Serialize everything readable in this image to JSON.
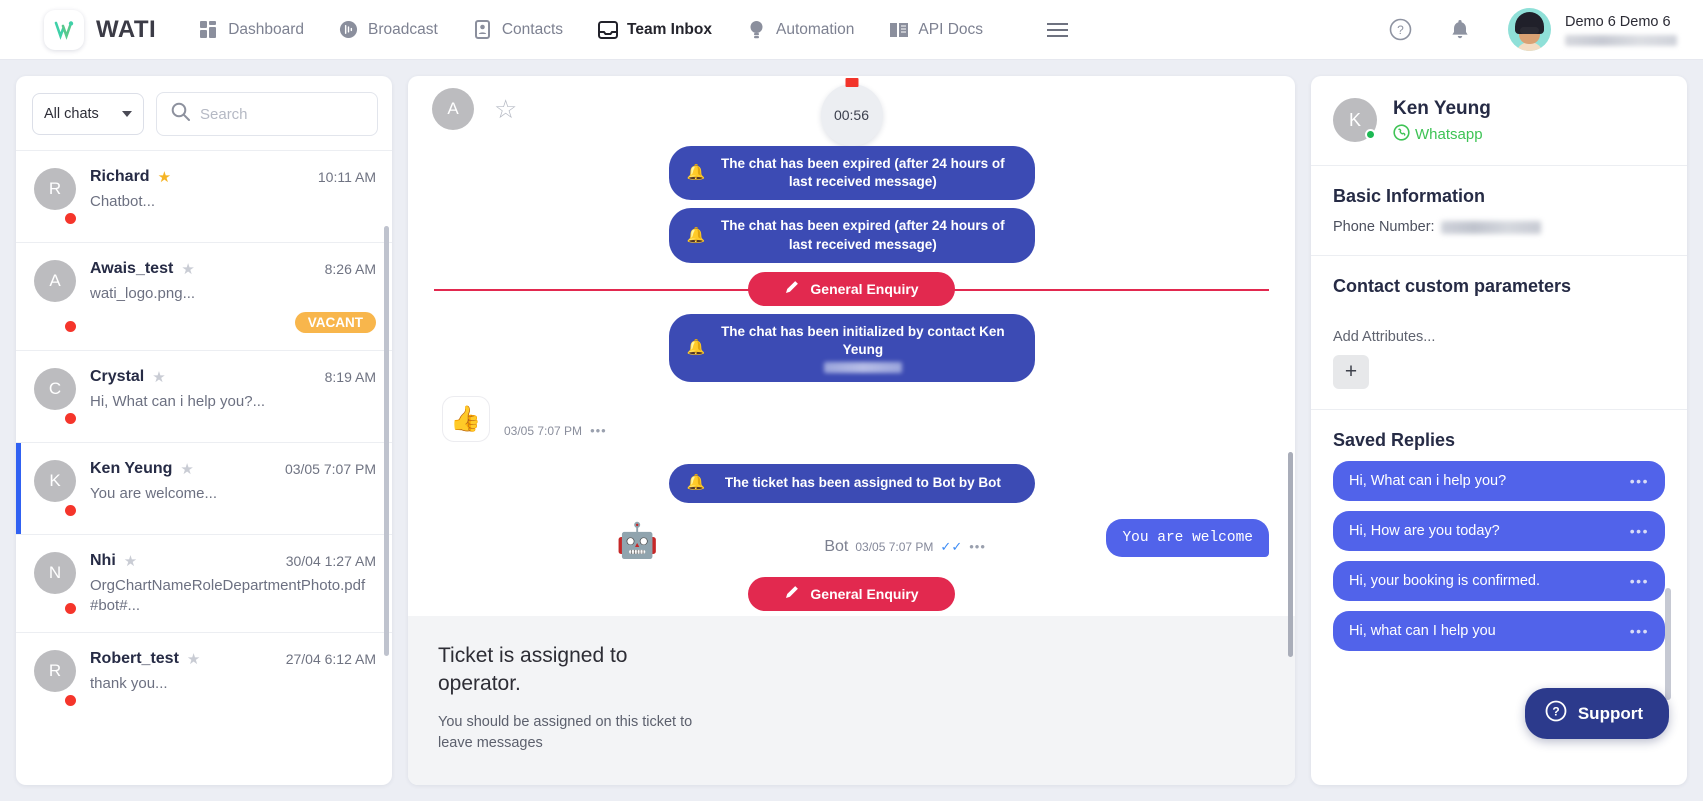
{
  "header": {
    "brand": "WATI",
    "nav": [
      {
        "label": "Dashboard",
        "icon": "dashboard-icon",
        "active": false
      },
      {
        "label": "Broadcast",
        "icon": "broadcast-icon",
        "active": false
      },
      {
        "label": "Contacts",
        "icon": "contacts-icon",
        "active": false
      },
      {
        "label": "Team Inbox",
        "icon": "inbox-icon",
        "active": true
      },
      {
        "label": "Automation",
        "icon": "bulb-icon",
        "active": false
      },
      {
        "label": "API Docs",
        "icon": "book-icon",
        "active": false
      }
    ],
    "menu_icon": "hamburger-icon",
    "help_icon": "help-circle-icon",
    "bell_icon": "bell-icon",
    "user_name": "Demo 6 Demo 6"
  },
  "chat_list": {
    "filter_label": "All chats",
    "search_placeholder": "Search",
    "items": [
      {
        "initial": "R",
        "name": "Richard",
        "time": "10:11 AM",
        "preview": "Chatbot...",
        "favorite": true,
        "unread": true,
        "badge": "",
        "selected": false
      },
      {
        "initial": "A",
        "name": "Awais_test",
        "time": "8:26 AM",
        "preview": "wati_logo.png...",
        "favorite": false,
        "unread": true,
        "badge": "VACANT",
        "selected": false
      },
      {
        "initial": "C",
        "name": "Crystal",
        "time": "8:19 AM",
        "preview": "Hi, What can i help you?...",
        "favorite": false,
        "unread": true,
        "badge": "",
        "selected": false
      },
      {
        "initial": "K",
        "name": "Ken Yeung",
        "time": "03/05 7:07 PM",
        "preview": "You are welcome...",
        "favorite": false,
        "unread": true,
        "badge": "",
        "selected": true
      },
      {
        "initial": "N",
        "name": "Nhi",
        "time": "30/04 1:27 AM",
        "preview": "OrgChartNameRoleDepartmentPhoto.pdf #bot#...",
        "favorite": false,
        "unread": true,
        "badge": "",
        "selected": false
      },
      {
        "initial": "R",
        "name": "Robert_test",
        "time": "27/04 6:12 AM",
        "preview": "thank you...",
        "favorite": false,
        "unread": true,
        "badge": "",
        "selected": false
      }
    ]
  },
  "conversation": {
    "header_initial": "A",
    "star_icon": "star-outline-icon",
    "timer": "00:56",
    "system_1": "The chat has been expired (after 24 hours of last received message)",
    "system_2": "The chat has been expired (after 24 hours of last received message)",
    "enquiry_label": "General Enquiry",
    "system_3": "The chat has been initialized by contact Ken Yeung",
    "emoji_message": "👍",
    "emoji_time": "03/05 7:07 PM",
    "system_4": "The ticket has been assigned to Bot by Bot",
    "bot_avatar": "🤖",
    "bot_name": "Bot",
    "bot_time": "03/05 7:07 PM",
    "outgoing_message": "You are welcome",
    "enquiry_label_2": "General Enquiry",
    "notice_title": "Ticket is assigned to operator.",
    "notice_sub": "You should be assigned on this ticket to leave messages"
  },
  "contact": {
    "initial": "K",
    "name": "Ken Yeung",
    "channel": "Whatsapp",
    "basic_info_title": "Basic Information",
    "phone_label": "Phone Number:",
    "custom_params_title": "Contact custom parameters",
    "add_attributes": "Add Attributes...",
    "add_button": "+",
    "saved_replies_title": "Saved Replies",
    "saved_replies": [
      "Hi, What can i help you?",
      "Hi, How are you today?",
      "Hi, your booking is confirmed.",
      "Hi, what can I help you"
    ]
  },
  "support": {
    "label": "Support",
    "icon": "help-circle-icon"
  }
}
